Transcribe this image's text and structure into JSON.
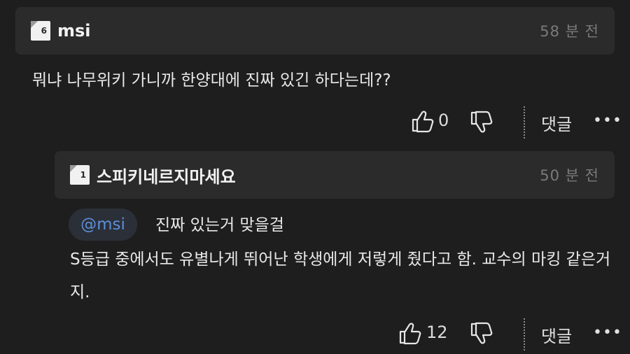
{
  "comments": [
    {
      "level_badge": "6",
      "username": "msi",
      "time": "58 분 전",
      "text": "뭐냐 나무위키 가니까 한양대에 진짜 있긴 하다는데??",
      "likes": "0",
      "reply_label": "댓글",
      "more_label": "•••"
    },
    {
      "level_badge": "1",
      "username": "스피키네르지마세요",
      "time": "50 분 전",
      "mention": "@msi",
      "first_line": "진짜 있는거 맞을걸",
      "text": "S등급 중에서도 유별나게 뛰어난 학생에게 저렇게 줬다고 함. 교수의 마킹 같은거지.",
      "likes": "12",
      "reply_label": "댓글",
      "more_label": "•••"
    }
  ],
  "colors": {
    "background": "#1e1e1e",
    "header_bg": "#2b2b2b",
    "mention_text": "#5b8fd9",
    "mention_bg": "#2b2f38"
  },
  "icons": [
    "thumbs-up-icon",
    "thumbs-down-icon",
    "more-icon"
  ]
}
